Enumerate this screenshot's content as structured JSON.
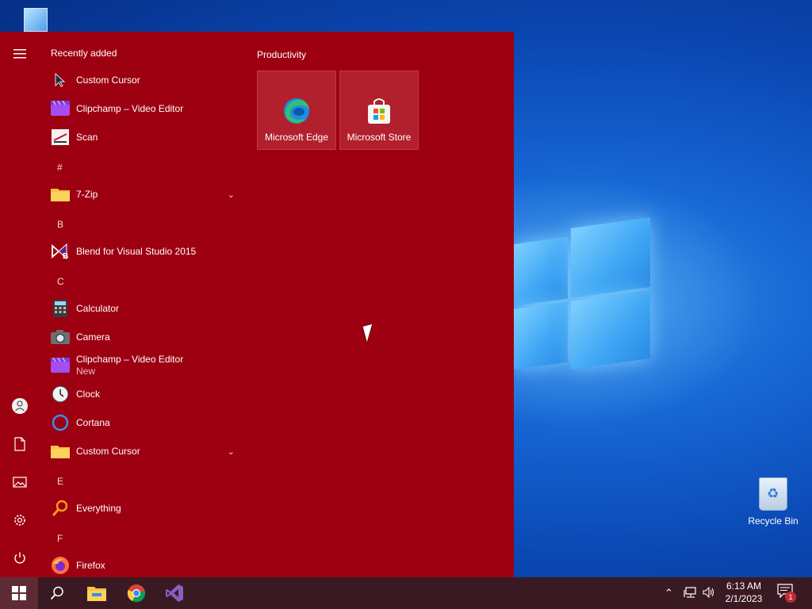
{
  "colors": {
    "start_background": "#9d0011",
    "tile_background": "#b1202c",
    "taskbar_background": "#3a1a22",
    "accent": "#c62837"
  },
  "start_menu": {
    "recently_added_header": "Recently added",
    "recently_added": [
      {
        "label": "Custom Cursor",
        "icon": "cursor-arrow-icon"
      },
      {
        "label": "Clipchamp – Video Editor",
        "icon": "clipchamp-icon"
      },
      {
        "label": "Scan",
        "icon": "scan-icon"
      }
    ],
    "sections": [
      {
        "letter": "#",
        "apps": [
          {
            "label": "7-Zip",
            "icon": "folder-icon",
            "expandable": true
          }
        ]
      },
      {
        "letter": "B",
        "apps": [
          {
            "label": "Blend for Visual Studio 2015",
            "icon": "blend-icon"
          }
        ]
      },
      {
        "letter": "C",
        "apps": [
          {
            "label": "Calculator",
            "icon": "calculator-icon"
          },
          {
            "label": "Camera",
            "icon": "camera-icon"
          },
          {
            "label": "Clipchamp – Video Editor",
            "sublabel": "New",
            "icon": "clipchamp-icon"
          },
          {
            "label": "Clock",
            "icon": "clock-icon"
          },
          {
            "label": "Cortana",
            "icon": "cortana-icon"
          },
          {
            "label": "Custom Cursor",
            "icon": "folder-icon",
            "expandable": true
          }
        ]
      },
      {
        "letter": "E",
        "apps": [
          {
            "label": "Everything",
            "icon": "search-magnifier-icon"
          }
        ]
      },
      {
        "letter": "F",
        "apps": [
          {
            "label": "Firefox",
            "icon": "firefox-icon"
          }
        ]
      }
    ],
    "rail": [
      "hamburger-menu-icon",
      "user-icon",
      "documents-icon",
      "pictures-icon",
      "settings-gear-icon",
      "power-icon"
    ],
    "tile_group": {
      "title": "Productivity",
      "tiles": [
        {
          "label": "Microsoft Edge",
          "icon": "edge-icon"
        },
        {
          "label": "Microsoft Store",
          "icon": "store-icon"
        }
      ]
    }
  },
  "desktop": {
    "recycle_bin_label": "Recycle Bin"
  },
  "taskbar": {
    "pinned": [
      "windows-start-icon",
      "search-icon",
      "file-explorer-icon",
      "chrome-icon",
      "visual-studio-icon"
    ],
    "tray": [
      "chevron-up-icon",
      "network-icon",
      "volume-icon"
    ],
    "time": "6:13 AM",
    "date": "2/1/2023",
    "notification_count": "1"
  }
}
